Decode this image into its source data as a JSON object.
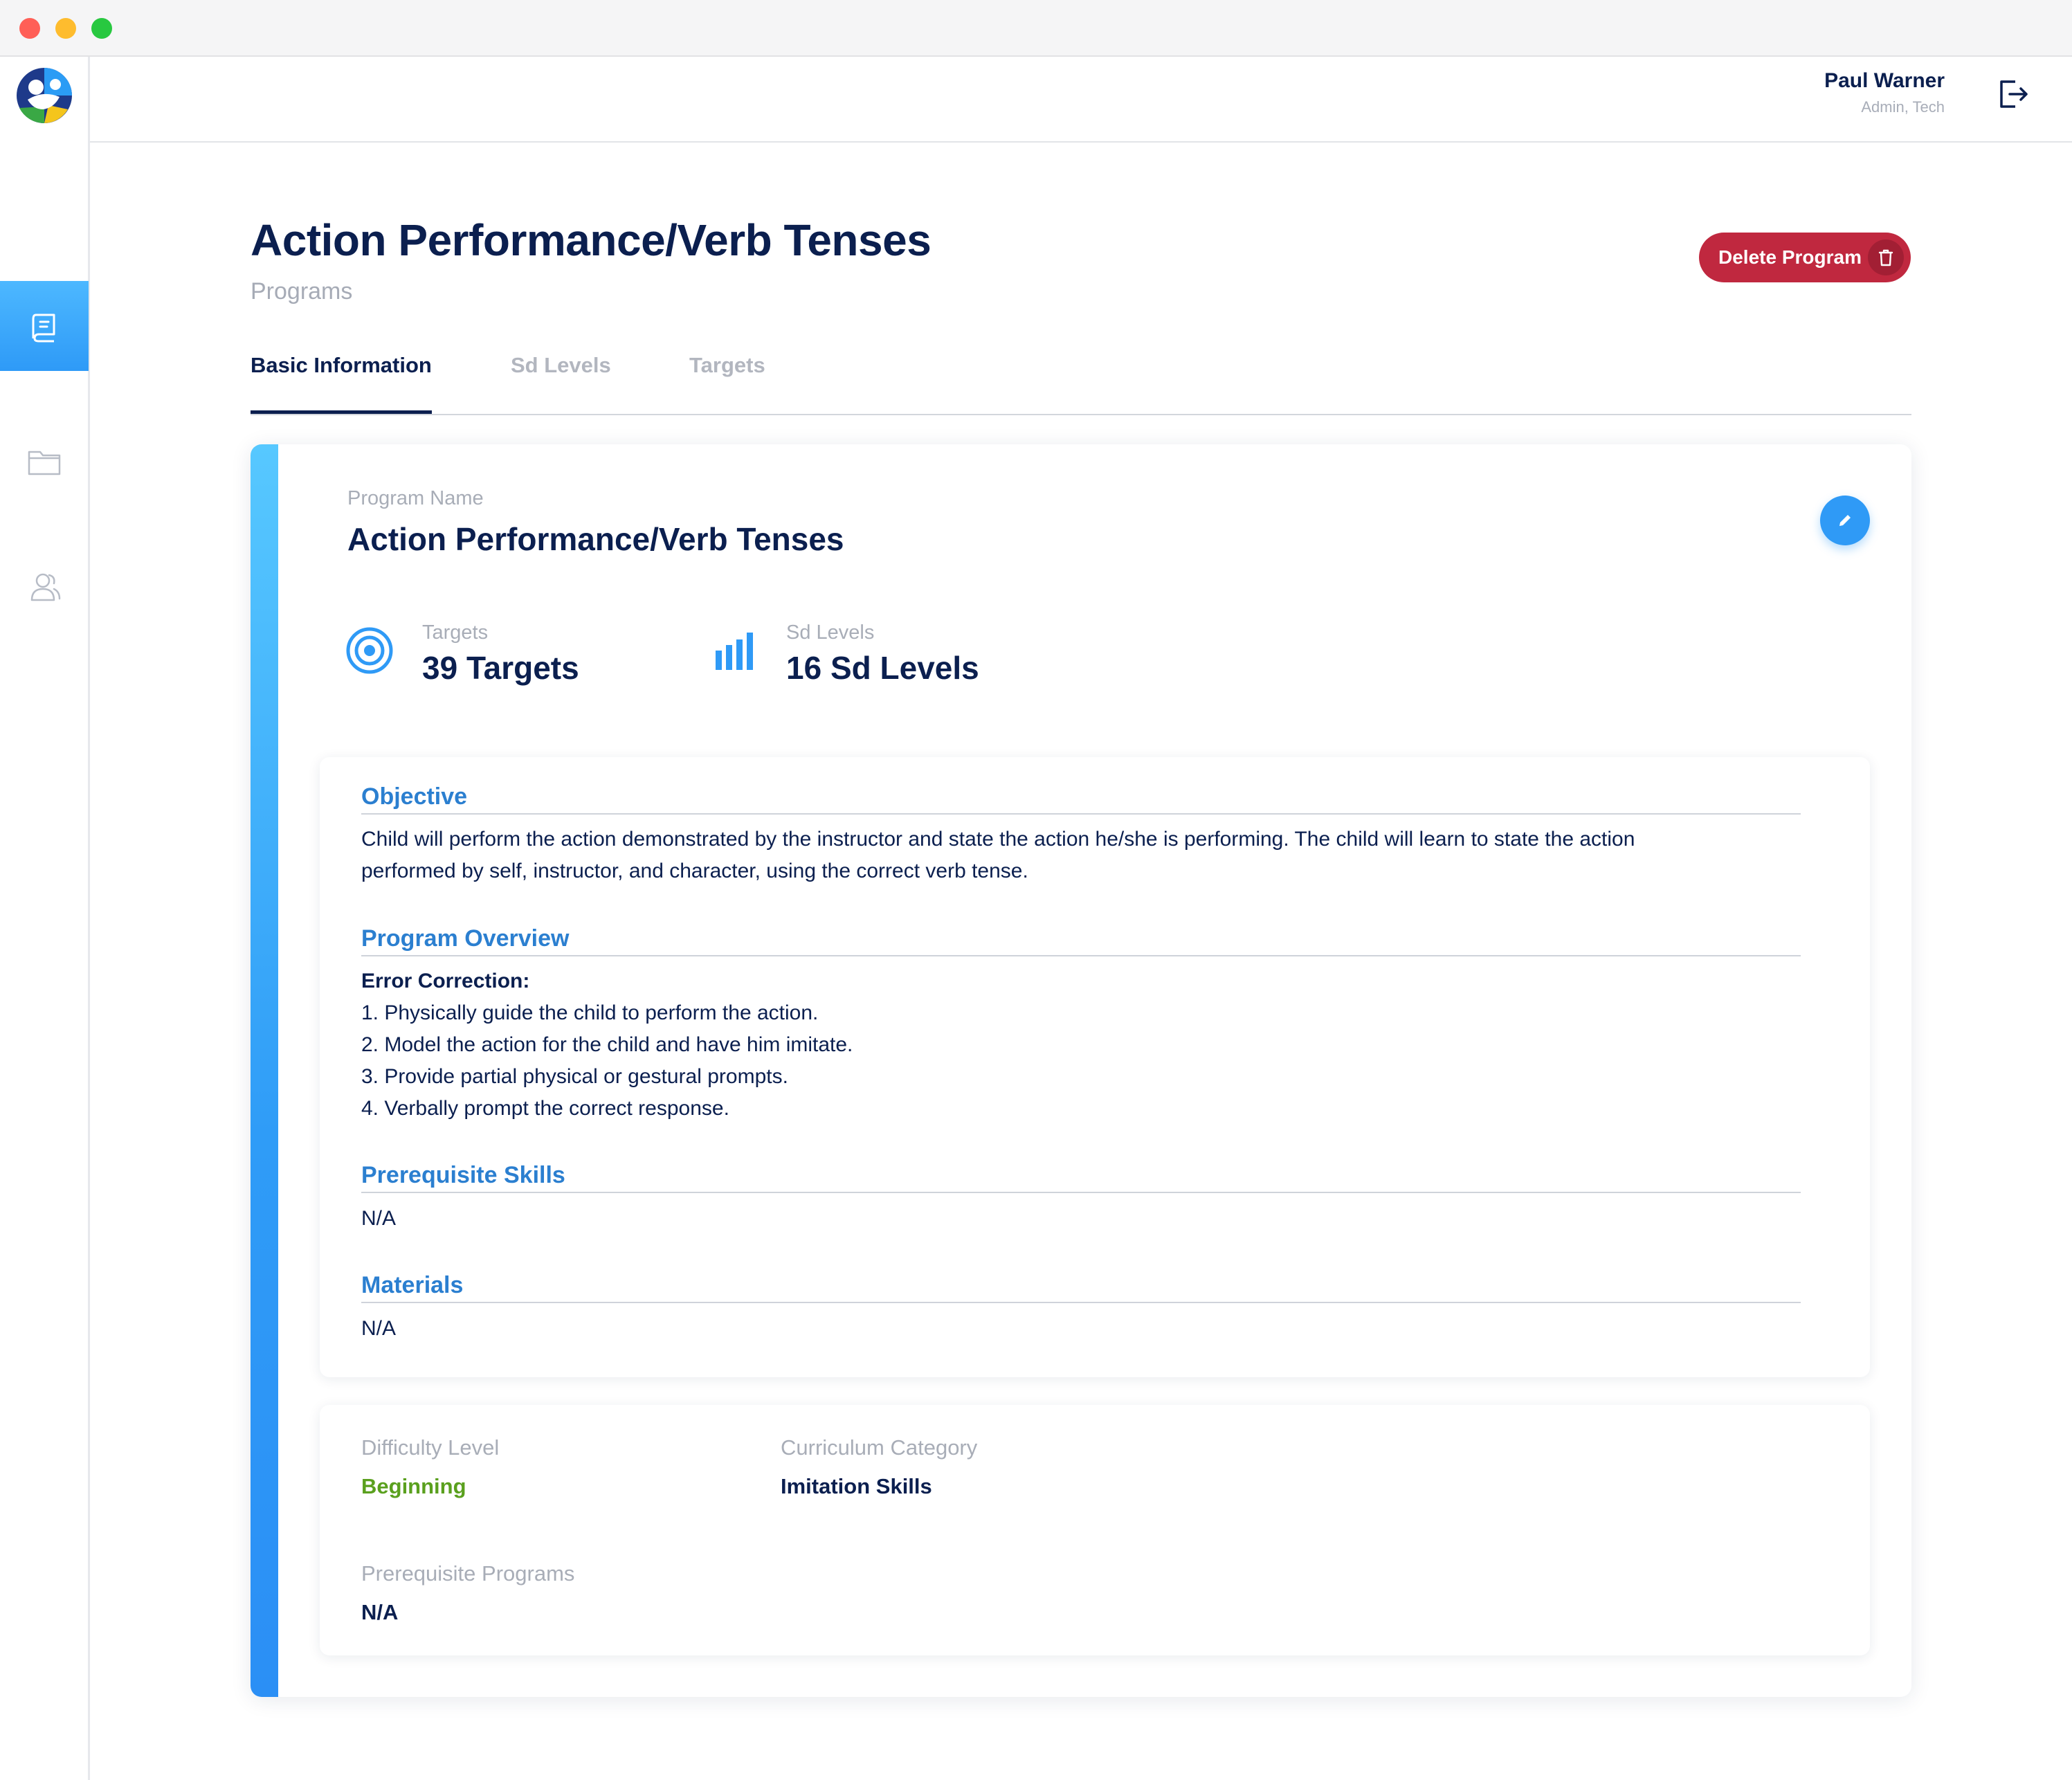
{
  "window": {
    "controls": [
      "close",
      "minimize",
      "maximize"
    ]
  },
  "sidebar": {
    "logo": "app-logo",
    "items": [
      {
        "icon": "book-icon",
        "active": true
      },
      {
        "icon": "folder-icon",
        "active": false
      },
      {
        "icon": "users-icon",
        "active": false
      }
    ]
  },
  "header": {
    "user_name": "Paul Warner",
    "user_role": "Admin, Tech",
    "logout_icon": "logout-icon"
  },
  "page": {
    "title": "Action Performance/Verb Tenses",
    "breadcrumb": "Programs",
    "delete_label": "Delete Program"
  },
  "tabs": [
    {
      "label": "Basic Information",
      "active": true
    },
    {
      "label": "Sd Levels",
      "active": false
    },
    {
      "label": "Targets",
      "active": false
    }
  ],
  "program": {
    "name_label": "Program Name",
    "name": "Action Performance/Verb Tenses",
    "stats": {
      "targets_label": "Targets",
      "targets_value": "39 Targets",
      "sd_label": "Sd Levels",
      "sd_value": "16 Sd Levels"
    }
  },
  "sections": {
    "objective_title": "Objective",
    "objective_line1": "Child will perform the action demonstrated by the instructor and state the action he/she is performing. The child will learn to state the action",
    "objective_line2": "performed by self, instructor, and character, using the correct verb tense.",
    "overview_title": "Program Overview",
    "overview_heading": "Error Correction:",
    "overview_steps": [
      "1. Physically guide the child to perform the action.",
      "2. Model the action for the child and have him imitate.",
      "3. Provide partial physical or gestural prompts.",
      "4. Verbally prompt the correct response."
    ],
    "prereq_title": "Prerequisite Skills",
    "prereq_text": "N/A",
    "materials_title": "Materials",
    "materials_text": "N/A"
  },
  "meta": {
    "difficulty_label": "Difficulty Level",
    "difficulty_value": "Beginning",
    "category_label": "Curriculum Category",
    "category_value": "Imitation Skills",
    "prereq_programs_label": "Prerequisite Programs",
    "prereq_programs_value": "N/A"
  },
  "colors": {
    "primary_navy": "#0b1f4f",
    "accent_blue": "#2f9af6",
    "section_blue": "#2b7fd0",
    "danger": "#c0283f",
    "success_green": "#5aa01e",
    "muted": "#a8adb7"
  }
}
